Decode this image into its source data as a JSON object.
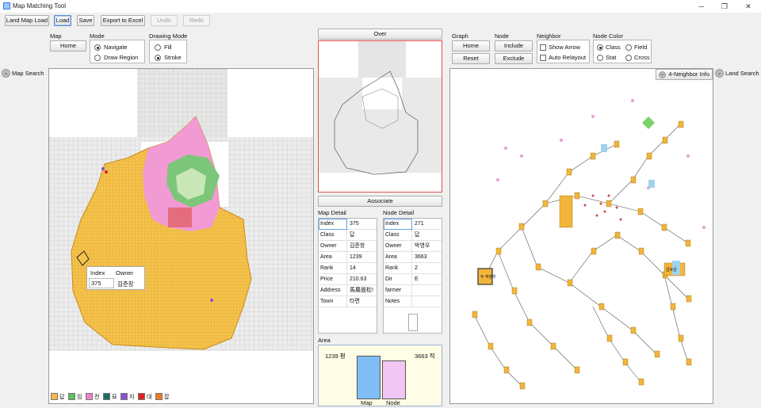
{
  "window": {
    "title": "Map Matching Tool",
    "min": "─",
    "max": "❐",
    "close": "✕"
  },
  "toolbar": {
    "land_map_load": "Land Map Load",
    "load": "Load",
    "save": "Save",
    "export": "Export to Excel",
    "undo": "Undo",
    "redo": "Redo"
  },
  "map_controls": {
    "map_label": "Map",
    "home": "Home",
    "mode_label": "Mode",
    "navigate": "Navigate",
    "draw_region": "Draw Region",
    "drawing_mode_label": "Drawing Mode",
    "fill": "Fill",
    "stroke": "Stroke"
  },
  "side": {
    "map_search": "Map Search",
    "land_search": "Land Search"
  },
  "over_button": "Over",
  "associate_button": "Associate",
  "graph_controls": {
    "graph_label": "Graph",
    "home": "Home",
    "reset": "Reset",
    "node_label": "Node",
    "include": "Include",
    "exclude": "Exclude",
    "neighbor_label": "Neighbor",
    "show_arrow": "Show Arrow",
    "auto_relayout": "Auto Relayout",
    "node_color_label": "Node Color",
    "class": "Class",
    "field": "Field",
    "stat": "Stat",
    "cross": "Cross"
  },
  "four_neighbor": "4-Neighbor Info",
  "map_detail": {
    "title": "Map Detail",
    "rows": [
      {
        "k": "Index",
        "v": "375"
      },
      {
        "k": "Class",
        "v": "답"
      },
      {
        "k": "Owner",
        "v": "김준창"
      },
      {
        "k": "Area",
        "v": "1239"
      },
      {
        "k": "Rank",
        "v": "14"
      },
      {
        "k": "Price",
        "v": "210.63"
      },
      {
        "k": "Address",
        "v": "馬農面松!"
      },
      {
        "k": "Town",
        "v": "타면"
      }
    ]
  },
  "node_detail": {
    "title": "Node Detail",
    "rows": [
      {
        "k": "Index",
        "v": "271"
      },
      {
        "k": "Class",
        "v": "답"
      },
      {
        "k": "Owner",
        "v": "박영우"
      },
      {
        "k": "Area",
        "v": "3663"
      },
      {
        "k": "Rank",
        "v": "2"
      },
      {
        "k": "Dir",
        "v": "E"
      },
      {
        "k": "farmer",
        "v": ""
      },
      {
        "k": "Notes",
        "v": ""
      }
    ]
  },
  "area_chart": {
    "title": "Area",
    "left_value": "1239 평",
    "right_value": "3663 적",
    "map_label": "Map",
    "node_label": "Node",
    "max": 3663,
    "map_area": 1239,
    "node_area": 3663
  },
  "tooltip": {
    "h1": "Index",
    "h2": "Owner",
    "v1": "375",
    "v2": "김준창"
  },
  "legend": [
    {
      "label": "답",
      "color": "#f5b942"
    },
    {
      "label": "임",
      "color": "#5fbf5a"
    },
    {
      "label": "전",
      "color": "#f080c8"
    },
    {
      "label": "묘",
      "color": "#1a6f6a"
    },
    {
      "label": "지",
      "color": "#8a4fd0"
    },
    {
      "label": "대",
      "color": "#e02020"
    },
    {
      "label": "잡",
      "color": "#f07a20"
    }
  ],
  "graph_labels": {
    "node_a": "두 박영우",
    "node_b": "금호원"
  },
  "colors": {
    "paddy": "#f5c24a",
    "forest": "#7cc67a",
    "field": "#f29ad3",
    "graph_node": "#f2b53a"
  }
}
